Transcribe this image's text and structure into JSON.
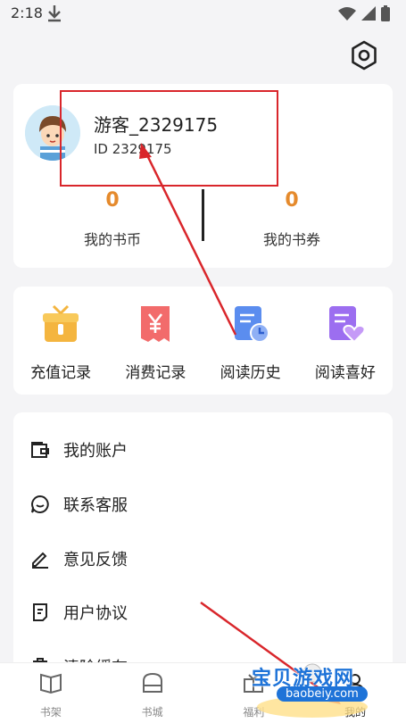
{
  "status": {
    "time": "2:18"
  },
  "profile": {
    "username": "游客_2329175",
    "user_id": "ID 2329175",
    "coins_value": "0",
    "coins_label": "我的书币",
    "vouchers_value": "0",
    "vouchers_label": "我的书券"
  },
  "quick_actions": [
    {
      "label": "充值记录",
      "icon": "gift-icon",
      "color": "#f4b53f"
    },
    {
      "label": "消费记录",
      "icon": "yen-receipt-icon",
      "color": "#f26b6b"
    },
    {
      "label": "阅读历史",
      "icon": "clock-document-icon",
      "color": "#5b8def"
    },
    {
      "label": "阅读喜好",
      "icon": "heart-document-icon",
      "color": "#9c6ef0"
    }
  ],
  "menu": [
    {
      "label": "我的账户",
      "icon": "wallet-icon"
    },
    {
      "label": "联系客服",
      "icon": "chat-icon"
    },
    {
      "label": "意见反馈",
      "icon": "pencil-icon"
    },
    {
      "label": "用户协议",
      "icon": "document-icon"
    },
    {
      "label": "清除缓存",
      "icon": "trash-icon"
    }
  ],
  "tabbar": [
    {
      "label": "书架",
      "icon": "book-icon",
      "active": false
    },
    {
      "label": "书城",
      "icon": "store-icon",
      "active": false
    },
    {
      "label": "福利",
      "icon": "gift-box-icon",
      "active": false
    },
    {
      "label": "我的",
      "icon": "user-icon",
      "active": true
    }
  ],
  "watermark": {
    "name": "宝贝游戏网",
    "url": "baobeiy.com"
  },
  "colors": {
    "accent_orange": "#e58a2c",
    "annotation_red": "#d9262b",
    "background": "#f4f4f6"
  }
}
